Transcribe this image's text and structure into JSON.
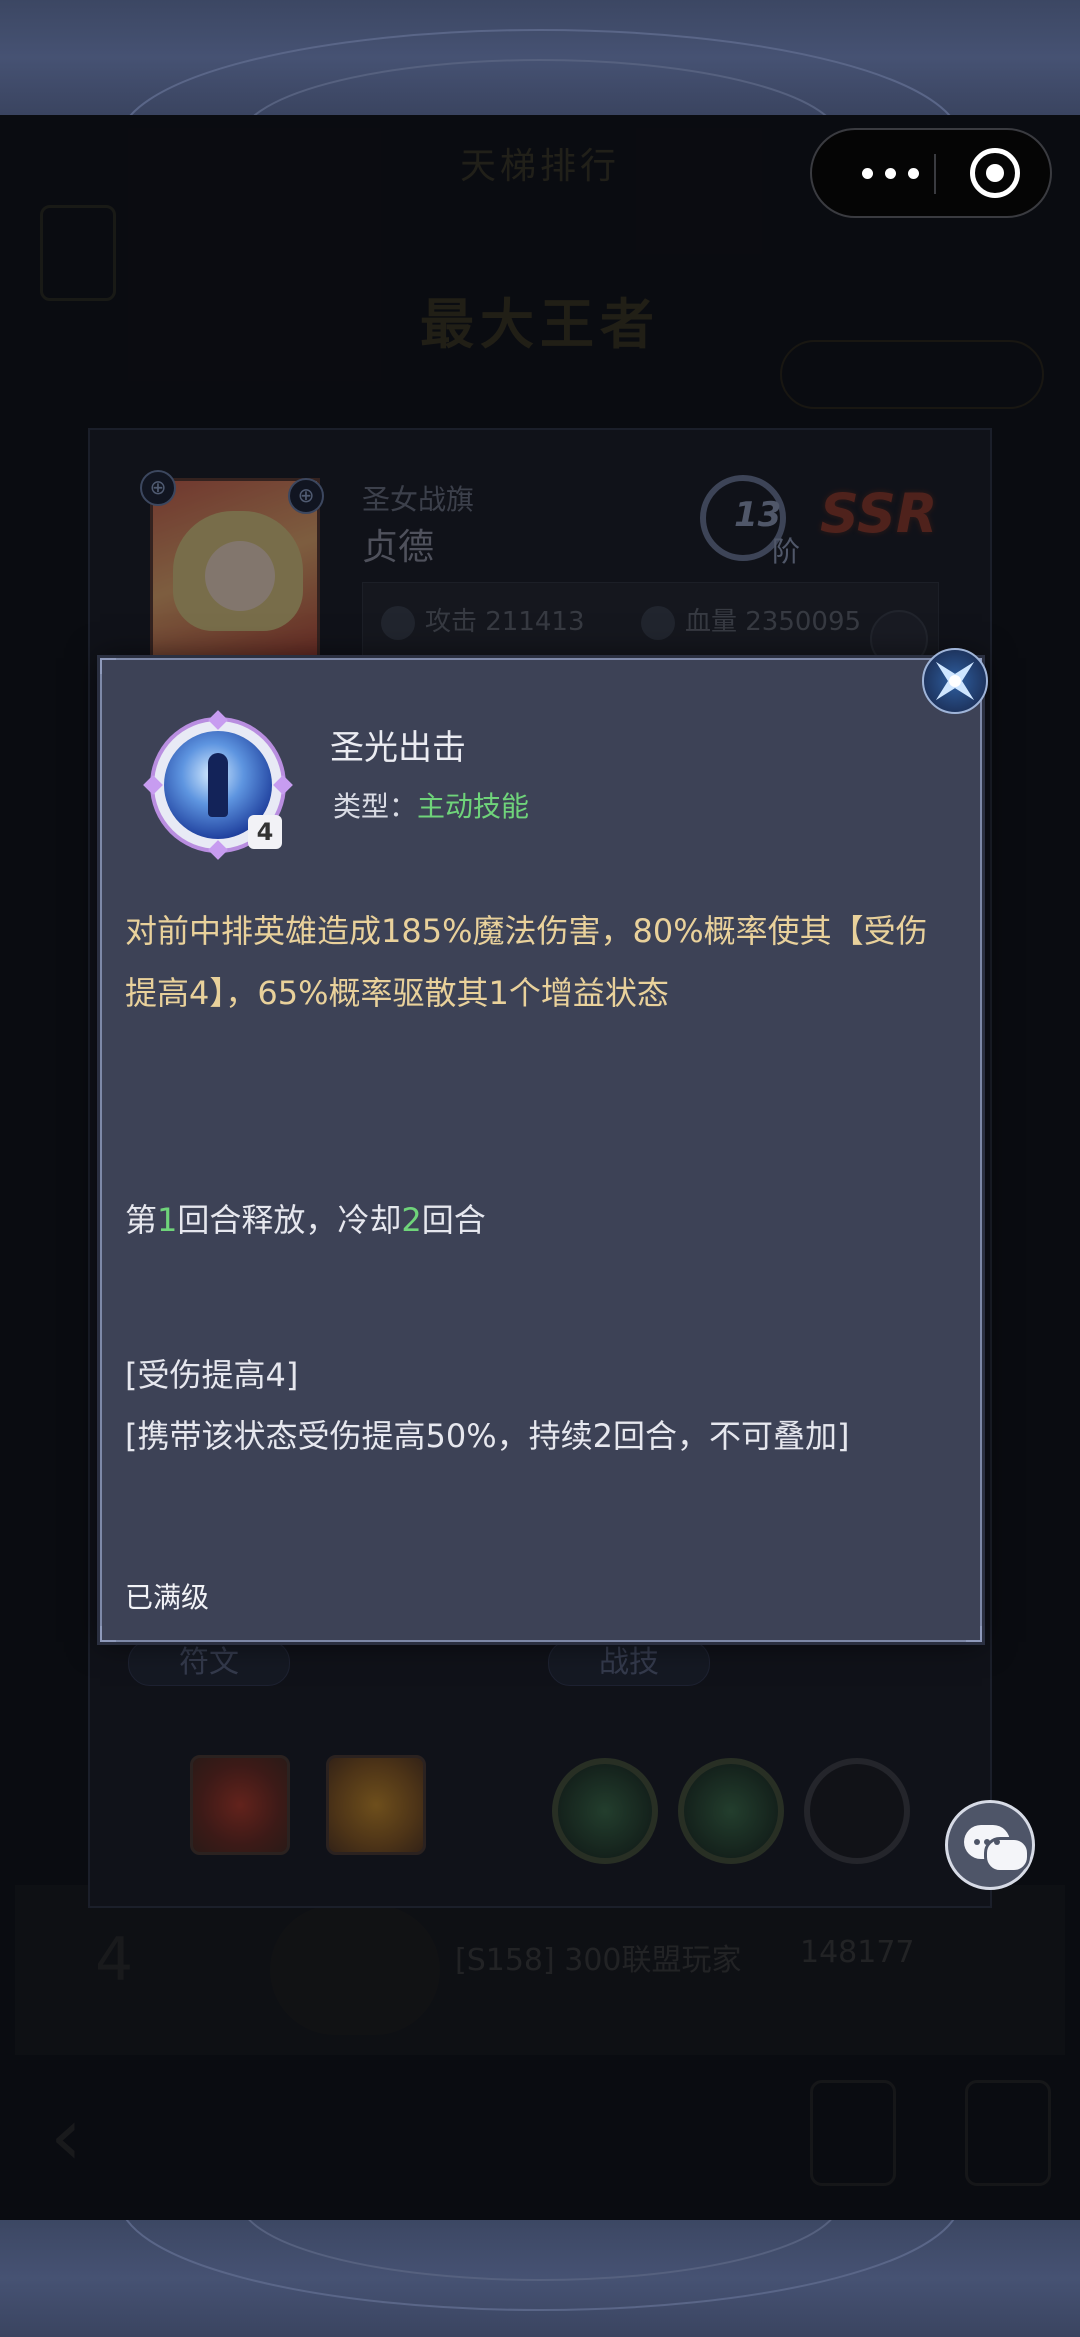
{
  "capsule": {
    "more_icon": "more-dots-icon",
    "close_icon": "target-circle-icon"
  },
  "background": {
    "title": "天梯排行",
    "rank_title": "最大王者",
    "row": {
      "rank": "4",
      "name": "[S158] 300联盟玩家",
      "value": "148177"
    }
  },
  "hero": {
    "subtitle": "圣女战旗",
    "name": "贞德",
    "stage_number": "13",
    "stage_unit": "阶",
    "rarity": "SSR",
    "attack_label": "攻击 211413",
    "hp_label": "血量 2350095"
  },
  "sections": {
    "rune_label": "符文",
    "battle_skill_label": "战技"
  },
  "popup": {
    "skill_name": "圣光出击",
    "type_label": "类型：",
    "type_value": "主动技能",
    "skill_level": "4",
    "description": "对前中排英雄造成185%魔法伤害，80%概率使其【受伤提高4】，65%概率驱散其1个增益状态",
    "timing_prefix": "第",
    "timing_round": "1",
    "timing_mid": "回合释放，冷却",
    "timing_cd": "2",
    "timing_suffix": "回合",
    "buff_title": "[受伤提高4]",
    "buff_description": "[携带该状态受伤提高50%，持续2回合，不可叠加]",
    "maxed": "已满级"
  },
  "colors": {
    "popup_bg": "#3d4256",
    "description_gold": "#e9d19b",
    "highlight_green": "#6fd47a",
    "text_white": "#e6e7ee"
  }
}
